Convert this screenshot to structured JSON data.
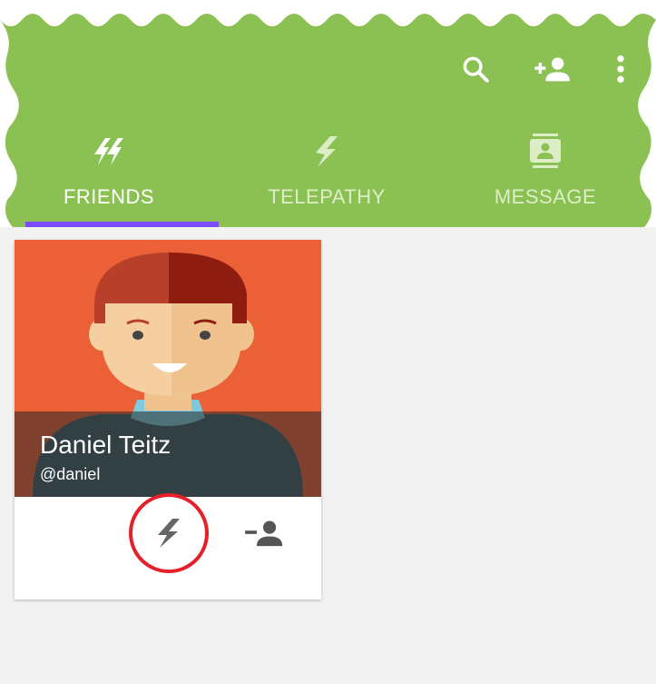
{
  "toolbar": {
    "actions": [
      {
        "icon": "search-icon"
      },
      {
        "icon": "add-friend-icon"
      },
      {
        "icon": "more-vert-icon"
      }
    ]
  },
  "tabs": [
    {
      "label": "FRIENDS",
      "icon": "friends-bolts-icon",
      "selected": true
    },
    {
      "label": "TELEPATHY",
      "icon": "telepathy-bolt-icon",
      "selected": false
    },
    {
      "label": "MESSAGE",
      "icon": "message-contact-icon",
      "selected": false
    }
  ],
  "friend_card": {
    "name": "Daniel Teitz",
    "handle": "@daniel",
    "actions": [
      {
        "icon": "telepathy-bolt-icon",
        "highlighted": true
      },
      {
        "icon": "remove-friend-icon",
        "highlighted": false
      }
    ]
  },
  "colors": {
    "appbar": "#8bc152",
    "tab_indicator": "#7c4dff",
    "card_background": "#ec6038",
    "highlight_ring": "#e5202a"
  }
}
